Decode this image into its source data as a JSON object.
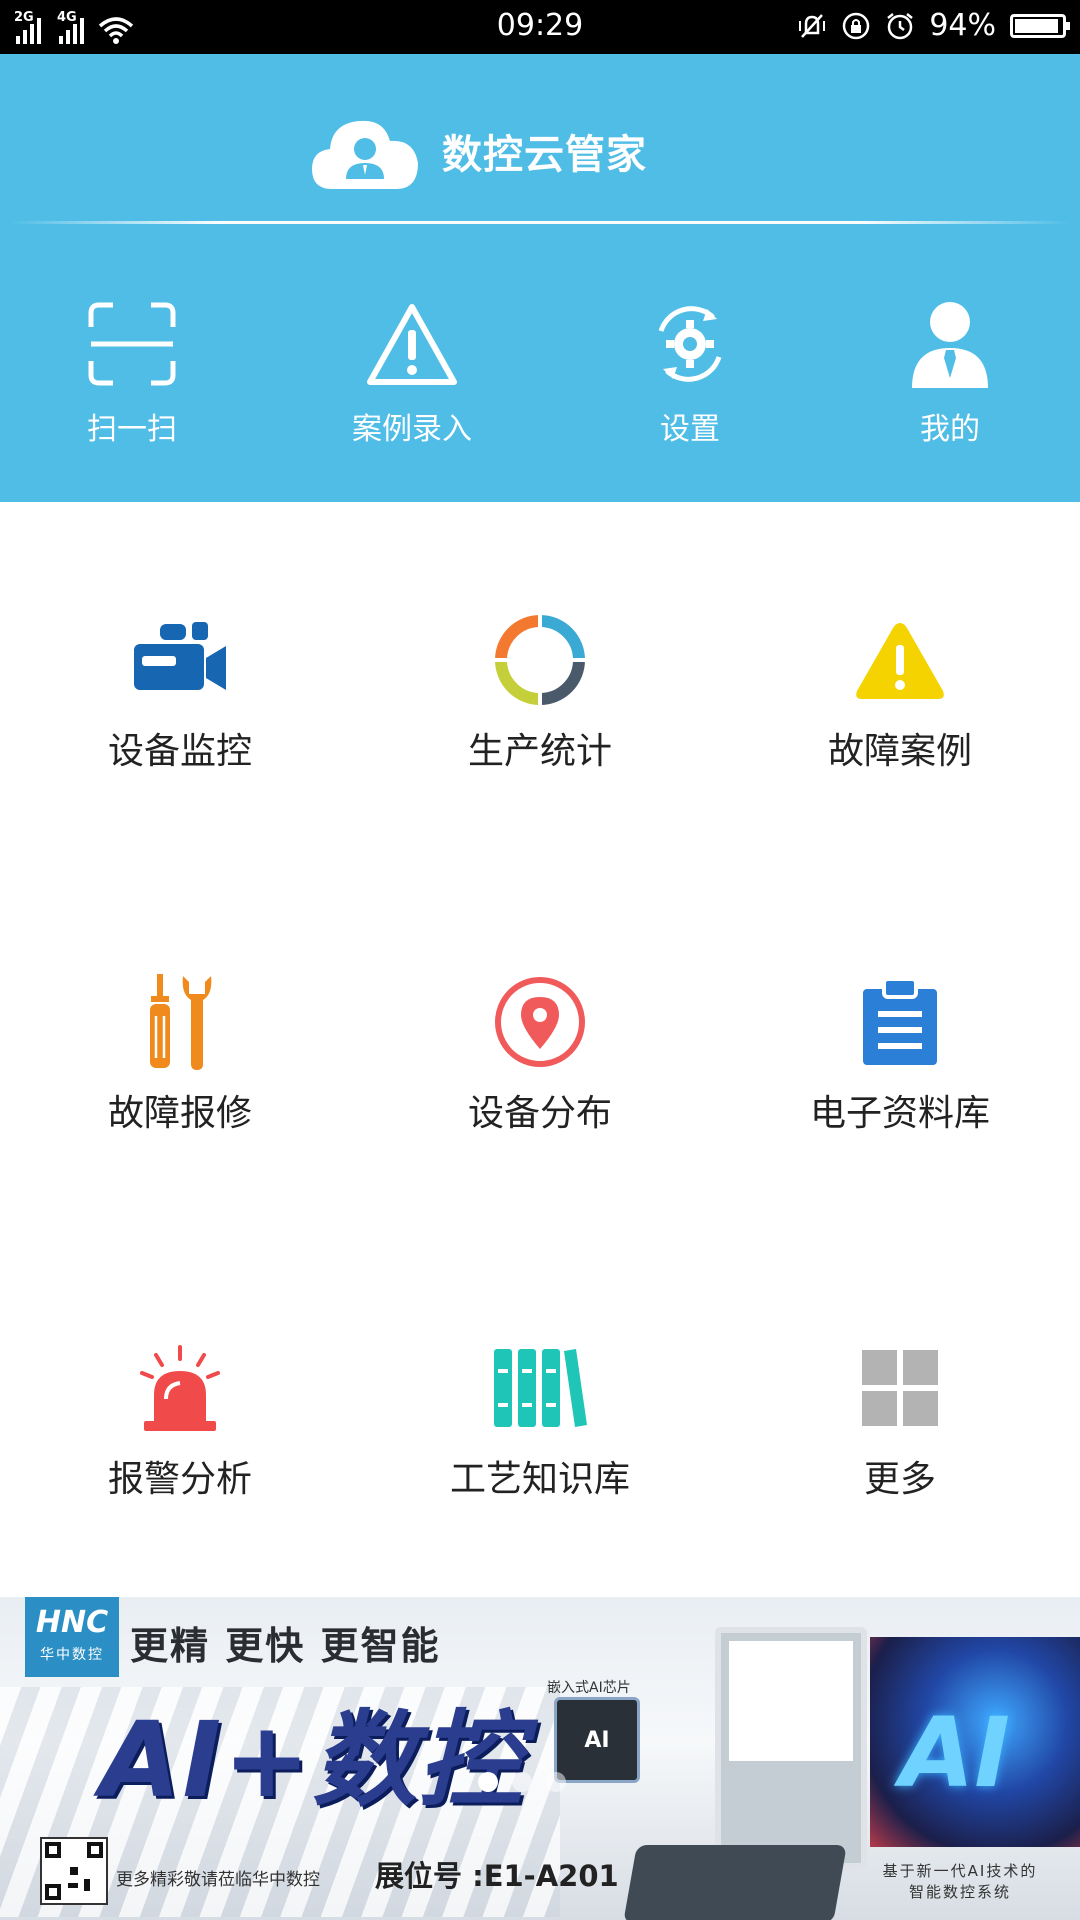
{
  "status_bar": {
    "network_1": "2G",
    "network_2": "4G",
    "time": "09:29",
    "battery": "94%",
    "battery_level": 0.94,
    "icons": [
      "signal-icon",
      "wifi-icon",
      "vibrate-icon",
      "rotation-lock-icon",
      "alarm-icon",
      "battery-icon"
    ]
  },
  "header": {
    "brand_title": "数控云管家",
    "brand_icon": "cloud-user-icon",
    "background_color": "#4fbde6",
    "actions": [
      {
        "label": "扫一扫",
        "icon": "scan-icon"
      },
      {
        "label": "案例录入",
        "icon": "warning-triangle-icon"
      },
      {
        "label": "设置",
        "icon": "settings-icon"
      },
      {
        "label": "我的",
        "icon": "user-icon"
      }
    ]
  },
  "grid": {
    "items": [
      {
        "label": "设备监控",
        "icon": "video-camera-icon",
        "color": "#1666b2"
      },
      {
        "label": "生产统计",
        "icon": "donut-chart-icon",
        "color": "#4a5a6a"
      },
      {
        "label": "故障案例",
        "icon": "warning-icon",
        "color": "#f5d300"
      },
      {
        "label": "故障报修",
        "icon": "tools-icon",
        "color": "#f08a1d"
      },
      {
        "label": "设备分布",
        "icon": "location-pin-icon",
        "color": "#f15a5a"
      },
      {
        "label": "电子资料库",
        "icon": "clipboard-icon",
        "color": "#2b7fd6"
      },
      {
        "label": "报警分析",
        "icon": "siren-icon",
        "color": "#f14a4a"
      },
      {
        "label": "工艺知识库",
        "icon": "books-icon",
        "color": "#1fc6b8"
      },
      {
        "label": "更多",
        "icon": "more-grid-icon",
        "color": "#b3b3b3"
      }
    ]
  },
  "banner": {
    "logo_text": "HNC",
    "logo_subtext": "华中数控",
    "slogan": "更精 更快 更智能",
    "title": "AI+数控",
    "chip_label": "嵌入式AI芯片",
    "chip_text": "AI",
    "visit_text": "更多精彩敬请莅临华中数控",
    "booth": "展位号 :E1-A201",
    "ai_slogan_line1": "基于新一代AI技术的",
    "ai_slogan_line2": "智能数控系统",
    "art_text": "AI",
    "carousel_count": 3,
    "carousel_active": 1
  }
}
